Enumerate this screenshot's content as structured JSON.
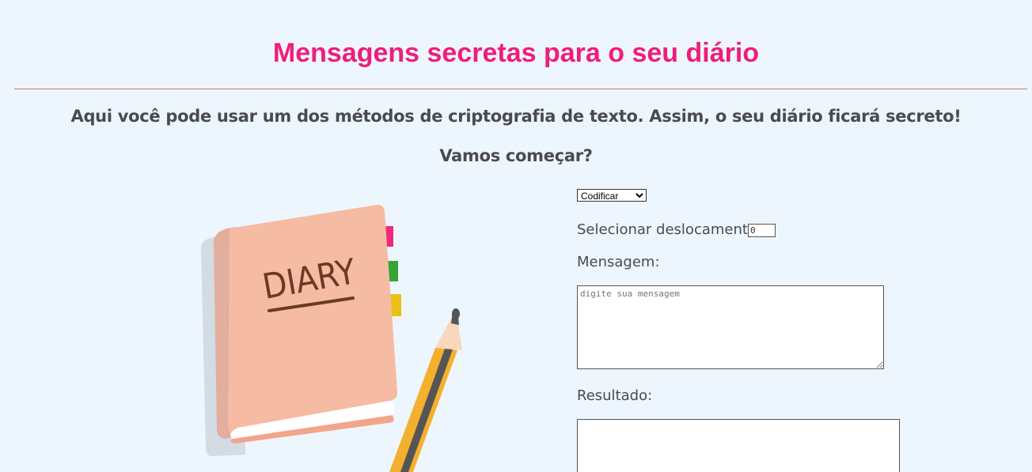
{
  "header": {
    "title": "Mensagens secretas para o seu diário",
    "subtitle": "Aqui você pode usar um dos métodos de criptografia de texto. Assim, o seu diário ficará secreto!",
    "lead": "Vamos começar?"
  },
  "illustration": {
    "label": "DIARY",
    "icons": [
      "diary-icon",
      "pencil-icon"
    ]
  },
  "form": {
    "mode_options": [
      "Codificar"
    ],
    "mode_selected": "Codificar",
    "shift_label": "Selecionar deslocamento:",
    "shift_value": "0",
    "message_label": "Mensagem:",
    "message_placeholder": "digite sua mensagem",
    "result_label": "Resultado:",
    "result_value": ""
  },
  "colors": {
    "background": "#eef6fd",
    "title": "#ef1d7d",
    "divider": "#c97a5f",
    "text": "#4a4a52",
    "diary_cover": "#f6bba3",
    "tab_pink": "#ee2a7b",
    "tab_green": "#3aa335",
    "tab_yellow": "#e8c215",
    "pencil_body": "#f3b02f"
  }
}
